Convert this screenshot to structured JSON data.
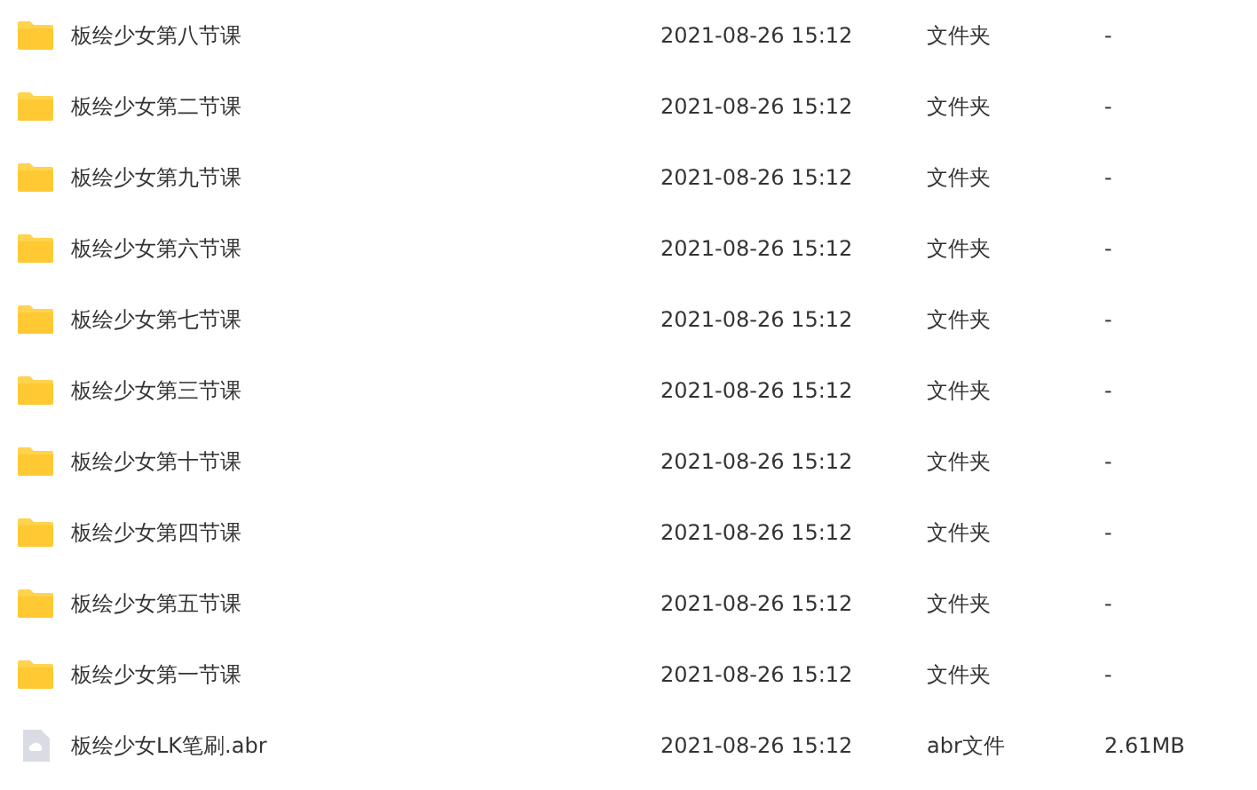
{
  "files": [
    {
      "kind": "folder",
      "name": "板绘少女第八节课",
      "modified": "2021-08-26 15:12",
      "type": "文件夹",
      "size": "-"
    },
    {
      "kind": "folder",
      "name": "板绘少女第二节课",
      "modified": "2021-08-26 15:12",
      "type": "文件夹",
      "size": "-"
    },
    {
      "kind": "folder",
      "name": "板绘少女第九节课",
      "modified": "2021-08-26 15:12",
      "type": "文件夹",
      "size": "-"
    },
    {
      "kind": "folder",
      "name": "板绘少女第六节课",
      "modified": "2021-08-26 15:12",
      "type": "文件夹",
      "size": "-"
    },
    {
      "kind": "folder",
      "name": "板绘少女第七节课",
      "modified": "2021-08-26 15:12",
      "type": "文件夹",
      "size": "-"
    },
    {
      "kind": "folder",
      "name": "板绘少女第三节课",
      "modified": "2021-08-26 15:12",
      "type": "文件夹",
      "size": "-"
    },
    {
      "kind": "folder",
      "name": "板绘少女第十节课",
      "modified": "2021-08-26 15:12",
      "type": "文件夹",
      "size": "-"
    },
    {
      "kind": "folder",
      "name": "板绘少女第四节课",
      "modified": "2021-08-26 15:12",
      "type": "文件夹",
      "size": "-"
    },
    {
      "kind": "folder",
      "name": "板绘少女第五节课",
      "modified": "2021-08-26 15:12",
      "type": "文件夹",
      "size": "-"
    },
    {
      "kind": "folder",
      "name": "板绘少女第一节课",
      "modified": "2021-08-26 15:12",
      "type": "文件夹",
      "size": "-"
    },
    {
      "kind": "file",
      "name": "板绘少女LK笔刷.abr",
      "modified": "2021-08-26 15:12",
      "type": "abr文件",
      "size": "2.61MB"
    }
  ]
}
